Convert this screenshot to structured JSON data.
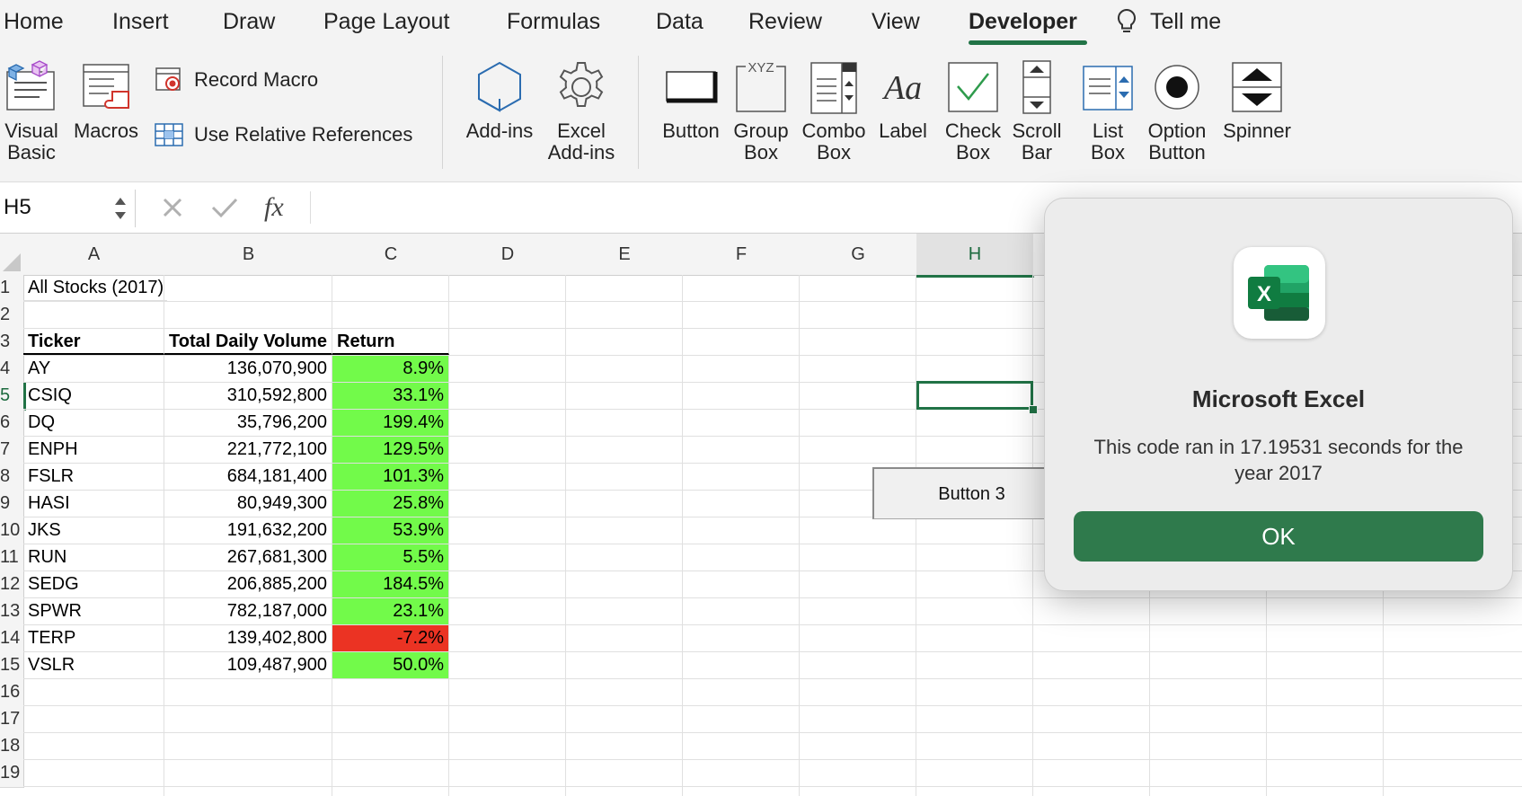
{
  "ribbon_tabs": [
    {
      "label": "Home"
    },
    {
      "label": "Insert"
    },
    {
      "label": "Draw"
    },
    {
      "label": "Page Layout"
    },
    {
      "label": "Formulas"
    },
    {
      "label": "Data"
    },
    {
      "label": "Review"
    },
    {
      "label": "View"
    },
    {
      "label": "Developer",
      "active": true
    }
  ],
  "tell_me": "Tell me",
  "ribbon": {
    "visual_basic": "Visual\nBasic",
    "macros": "Macros",
    "record_macro": "Record Macro",
    "use_relative_refs": "Use Relative References",
    "add_ins": "Add-ins",
    "excel_add_ins": "Excel\nAdd-ins",
    "button": "Button",
    "group_box": "Group\nBox",
    "combo_box": "Combo\nBox",
    "label": "Label",
    "check_box": "Check\nBox",
    "scroll_bar": "Scroll\nBar",
    "list_box": "List\nBox",
    "option_button": "Option\nButton",
    "spinner": "Spinner"
  },
  "formula_bar": {
    "name_box": "H5",
    "fx": "fx",
    "formula": ""
  },
  "columns": [
    "A",
    "B",
    "C",
    "D",
    "E",
    "F",
    "G",
    "H"
  ],
  "selected_column": "H",
  "row_numbers": [
    "1",
    "2",
    "3",
    "4",
    "5",
    "6",
    "7",
    "8",
    "9",
    "10",
    "11",
    "12",
    "13",
    "14",
    "15",
    "16",
    "17",
    "18",
    "19"
  ],
  "selected_row": "5",
  "sheet": {
    "title": "All Stocks (2017)",
    "headers": {
      "ticker": "Ticker",
      "volume": "Total Daily Volume",
      "return": "Return"
    },
    "rows": [
      {
        "ticker": "AY",
        "volume": "136,070,900",
        "return": "8.9%",
        "status": "positive"
      },
      {
        "ticker": "CSIQ",
        "volume": "310,592,800",
        "return": "33.1%",
        "status": "positive"
      },
      {
        "ticker": "DQ",
        "volume": "35,796,200",
        "return": "199.4%",
        "status": "positive"
      },
      {
        "ticker": "ENPH",
        "volume": "221,772,100",
        "return": "129.5%",
        "status": "positive"
      },
      {
        "ticker": "FSLR",
        "volume": "684,181,400",
        "return": "101.3%",
        "status": "positive"
      },
      {
        "ticker": "HASI",
        "volume": "80,949,300",
        "return": "25.8%",
        "status": "positive"
      },
      {
        "ticker": "JKS",
        "volume": "191,632,200",
        "return": "53.9%",
        "status": "positive"
      },
      {
        "ticker": "RUN",
        "volume": "267,681,300",
        "return": "5.5%",
        "status": "positive"
      },
      {
        "ticker": "SEDG",
        "volume": "206,885,200",
        "return": "184.5%",
        "status": "positive"
      },
      {
        "ticker": "SPWR",
        "volume": "782,187,000",
        "return": "23.1%",
        "status": "positive"
      },
      {
        "ticker": "TERP",
        "volume": "139,402,800",
        "return": "-7.2%",
        "status": "negative"
      },
      {
        "ticker": "VSLR",
        "volume": "109,487,900",
        "return": "50.0%",
        "status": "positive"
      }
    ]
  },
  "form_button": "Button 3",
  "dialog": {
    "title": "Microsoft Excel",
    "message": "This code ran in 17.19531 seconds for the year 2017",
    "ok": "OK"
  },
  "colors": {
    "accent": "#217346",
    "positive": "#72fa4a",
    "negative": "#eb3323",
    "ok_button": "#2f7a4c"
  }
}
